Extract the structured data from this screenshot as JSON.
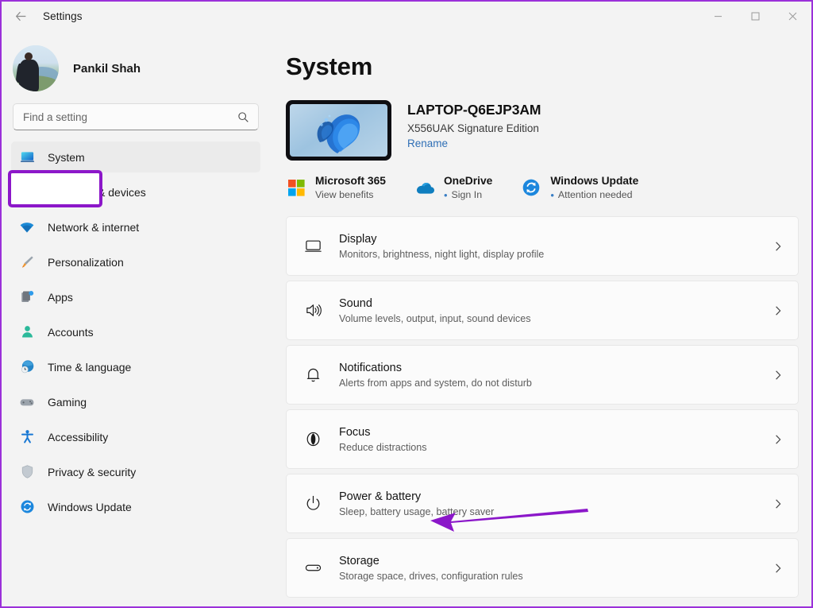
{
  "window": {
    "title": "Settings",
    "back_icon": "back-arrow-icon",
    "minimize_label": "—",
    "maximize_label": "□",
    "close_label": "✕"
  },
  "sidebar": {
    "profile": {
      "name": "Pankil Shah",
      "avatar": "user-avatar"
    },
    "search": {
      "placeholder": "Find a setting",
      "value": "",
      "icon": "search-icon"
    },
    "items": [
      {
        "label": "System",
        "icon": "monitor-icon",
        "active": true
      },
      {
        "label": "Bluetooth & devices",
        "icon": "bluetooth-icon",
        "active": false
      },
      {
        "label": "Network & internet",
        "icon": "wifi-icon",
        "active": false
      },
      {
        "label": "Personalization",
        "icon": "paintbrush-icon",
        "active": false
      },
      {
        "label": "Apps",
        "icon": "apps-icon",
        "active": false
      },
      {
        "label": "Accounts",
        "icon": "person-icon",
        "active": false
      },
      {
        "label": "Time & language",
        "icon": "clock-globe-icon",
        "active": false
      },
      {
        "label": "Gaming",
        "icon": "gamepad-icon",
        "active": false
      },
      {
        "label": "Accessibility",
        "icon": "accessibility-icon",
        "active": false
      },
      {
        "label": "Privacy & security",
        "icon": "shield-icon",
        "active": false
      },
      {
        "label": "Windows Update",
        "icon": "update-refresh-icon",
        "active": false
      }
    ]
  },
  "main": {
    "page_title": "System",
    "device": {
      "name": "LAPTOP-Q6EJP3AM",
      "model": "X556UAK Signature Edition",
      "rename_label": "Rename",
      "thumbnail": "windows-bloom-wallpaper"
    },
    "quick_links": [
      {
        "title": "Microsoft 365",
        "subtitle": "View benefits",
        "icon": "microsoft-logo-icon",
        "has_dot": false
      },
      {
        "title": "OneDrive",
        "subtitle": "Sign In",
        "icon": "onedrive-cloud-icon",
        "has_dot": true
      },
      {
        "title": "Windows Update",
        "subtitle": "Attention needed",
        "icon": "update-refresh-icon",
        "has_dot": true
      }
    ],
    "settings_rows": [
      {
        "title": "Display",
        "subtitle": "Monitors, brightness, night light, display profile",
        "icon": "display-monitor-icon"
      },
      {
        "title": "Sound",
        "subtitle": "Volume levels, output, input, sound devices",
        "icon": "speaker-icon"
      },
      {
        "title": "Notifications",
        "subtitle": "Alerts from apps and system, do not disturb",
        "icon": "bell-icon"
      },
      {
        "title": "Focus",
        "subtitle": "Reduce distractions",
        "icon": "focus-moon-icon"
      },
      {
        "title": "Power & battery",
        "subtitle": "Sleep, battery usage, battery saver",
        "icon": "power-icon"
      },
      {
        "title": "Storage",
        "subtitle": "Storage space, drives, configuration rules",
        "icon": "storage-drive-icon"
      }
    ],
    "chevron_icon": "chevron-right-icon"
  },
  "annotations": {
    "highlight_color": "#8c17c9",
    "arrow_color": "#8b17c9",
    "highlight_target": "System",
    "arrow_target": "Power & battery"
  }
}
